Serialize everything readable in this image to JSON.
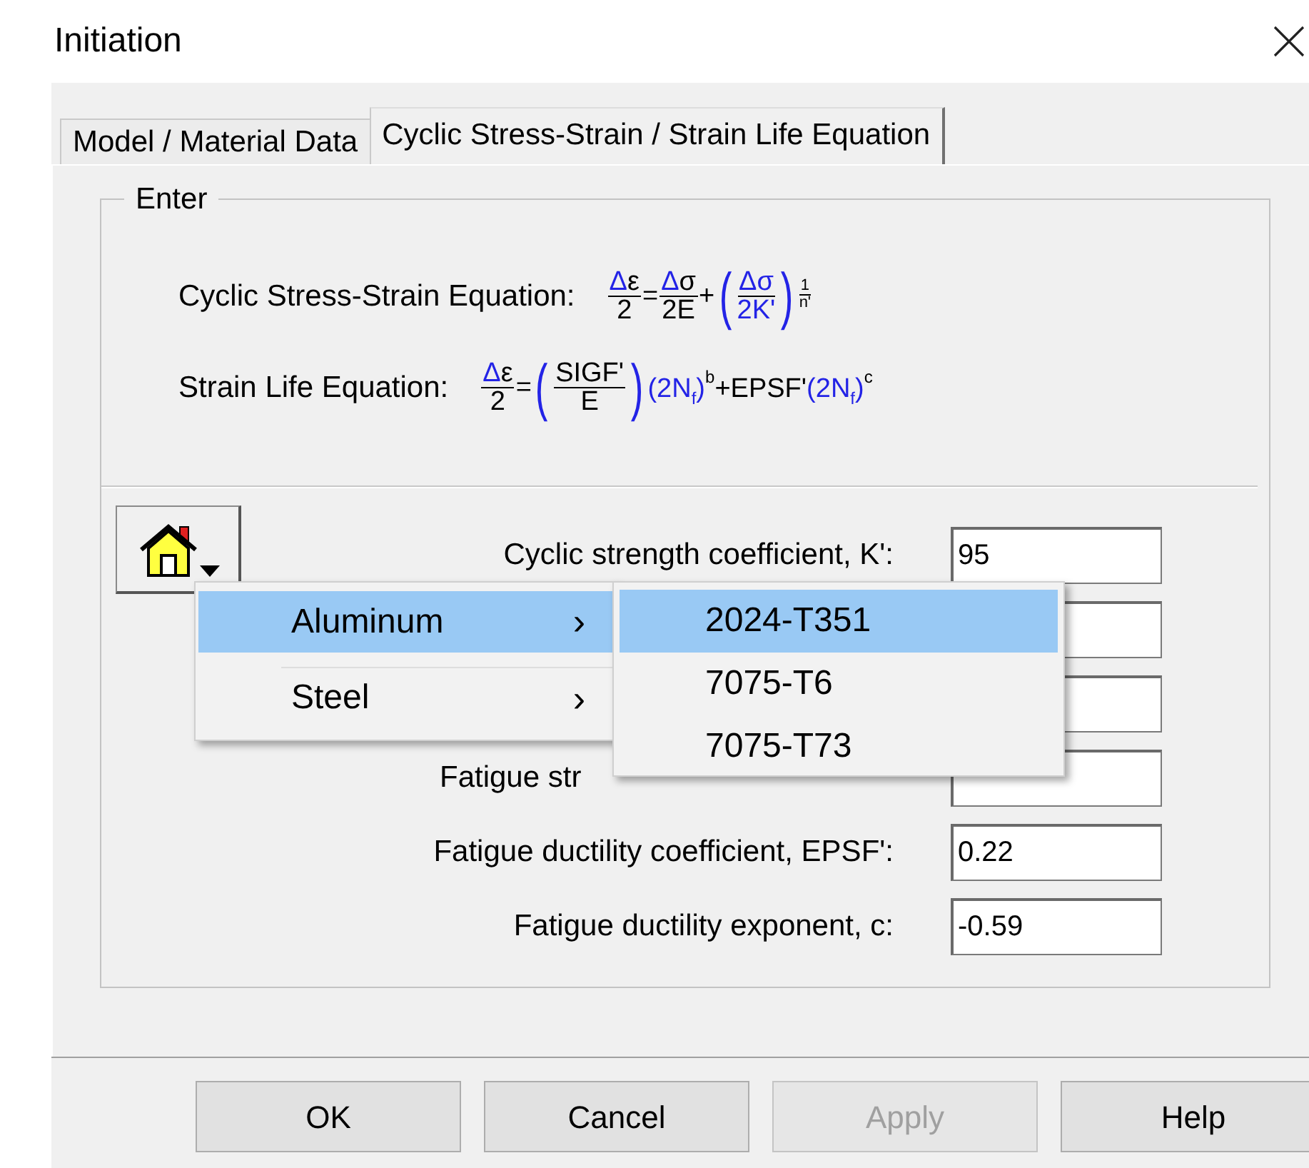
{
  "window": {
    "title": "Initiation"
  },
  "tabs": [
    {
      "label": "Model / Material Data",
      "selected": false
    },
    {
      "label": "Cyclic Stress-Strain / Strain Life Equation",
      "selected": true
    }
  ],
  "group": {
    "legend": "Enter",
    "equations": [
      {
        "label": "Cyclic Stress-Strain Equation:",
        "tokens": [
          {
            "kind": "frac",
            "num": [
              {
                "text": "Δ",
                "color": "#2323e6"
              },
              {
                "text": "ε"
              }
            ],
            "den": [
              {
                "text": "2"
              }
            ]
          },
          {
            "kind": "text",
            "pieces": [
              {
                "text": "="
              }
            ]
          },
          {
            "kind": "frac",
            "num": [
              {
                "text": "Δ",
                "color": "#2323e6"
              },
              {
                "text": "σ"
              }
            ],
            "den": [
              {
                "text": "2E"
              }
            ]
          },
          {
            "kind": "text",
            "pieces": [
              {
                "text": "+"
              }
            ]
          },
          {
            "kind": "group",
            "open": "(",
            "close": ")",
            "color": "#2323e6",
            "items": [
              {
                "kind": "frac",
                "num": [
                  {
                    "text": "Δσ",
                    "color": "#2323e6"
                  }
                ],
                "den": [
                  {
                    "text": "2K'",
                    "color": "#2323e6"
                  }
                ]
              }
            ],
            "sup": {
              "kind": "frac",
              "num": [
                {
                  "text": "1"
                }
              ],
              "den": [
                {
                  "text": "n'"
                }
              ]
            }
          }
        ]
      },
      {
        "label": "Strain Life Equation:",
        "tokens": [
          {
            "kind": "frac",
            "num": [
              {
                "text": "Δ",
                "color": "#2323e6"
              },
              {
                "text": "ε"
              }
            ],
            "den": [
              {
                "text": "2"
              }
            ]
          },
          {
            "kind": "text",
            "pieces": [
              {
                "text": "="
              }
            ]
          },
          {
            "kind": "group",
            "open": "(",
            "close": ")",
            "color": "#2323e6",
            "items": [
              {
                "kind": "frac",
                "num": [
                  {
                    "text": "SIGF'"
                  }
                ],
                "den": [
                  {
                    "text": "E"
                  }
                ]
              }
            ]
          },
          {
            "kind": "text",
            "pieces": [
              {
                "text": "(2N",
                "color": "#2323e6"
              },
              {
                "text": "f",
                "color": "#2323e6",
                "kind": "sub"
              },
              {
                "text": ")",
                "color": "#2323e6"
              },
              {
                "text": "b",
                "kind": "sup"
              },
              {
                "text": "+EPSF'"
              },
              {
                "text": "(2N",
                "color": "#2323e6"
              },
              {
                "text": "f",
                "color": "#2323e6",
                "kind": "sub"
              },
              {
                "text": ")",
                "color": "#2323e6"
              },
              {
                "text": "c",
                "kind": "sup"
              }
            ]
          }
        ]
      }
    ],
    "fields": [
      {
        "kind": "full",
        "label": "Cyclic strength coefficient, K':",
        "value": "95"
      },
      {
        "kind": "covered"
      },
      {
        "kind": "covered"
      },
      {
        "kind": "covered",
        "label": "Fatigue str"
      },
      {
        "kind": "full",
        "label": "Fatigue ductility coefficient, EPSF':",
        "value": "0.22"
      },
      {
        "kind": "full",
        "label": "Fatigue ductility exponent, c:",
        "value": "-0.59"
      }
    ]
  },
  "menu": {
    "items": [
      {
        "label": "Aluminum",
        "arrow": "›",
        "selected": true
      },
      {
        "label": "Steel",
        "arrow": "›",
        "selected": false
      }
    ],
    "submenu": [
      {
        "label": "2024-T351",
        "selected": true
      },
      {
        "label": "7075-T6",
        "selected": false
      },
      {
        "label": "7075-T73",
        "selected": false
      }
    ]
  },
  "buttons": [
    {
      "label": "OK",
      "disabled": false
    },
    {
      "label": "Cancel",
      "disabled": false
    },
    {
      "label": "Apply",
      "disabled": true
    },
    {
      "label": "Help",
      "disabled": false
    }
  ]
}
